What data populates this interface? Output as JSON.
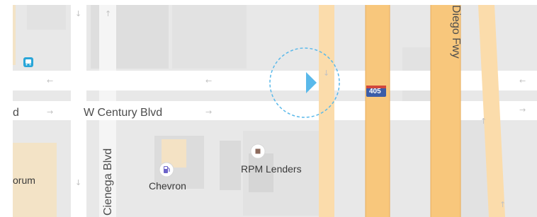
{
  "map": {
    "streets": {
      "w_century_blvd": "W Century Blvd",
      "w_century_blvd_left": "d",
      "la_cienega_blvd": "Cienega Blvd",
      "freeway": "Diego Fwy"
    },
    "shields": {
      "interstate": "405"
    },
    "pois": {
      "chevron": "Chevron",
      "rpm_lenders": "RPM Lenders",
      "forum": "orum"
    },
    "icons": {
      "transit": "bus-stop-icon",
      "gas": "gas-station-icon",
      "poi": "shop-marker-icon",
      "location": "location-pointer-icon"
    },
    "colors": {
      "land": "#e8e8e8",
      "road": "#ffffff",
      "freeway": "#f8c77c",
      "freeway_secondary": "#fbdcab",
      "building": "#dcdcdc",
      "interstate_blue": "#3b5da8",
      "location_blue": "#5ab9ea"
    }
  }
}
